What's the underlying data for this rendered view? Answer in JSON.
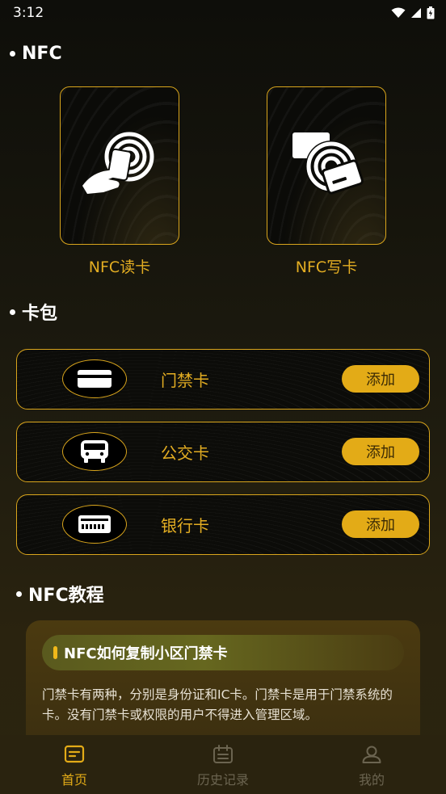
{
  "status_bar": {
    "time": "3:12"
  },
  "sections": {
    "nfc": "NFC",
    "wallet": "卡包",
    "tutorial": "NFC教程"
  },
  "nfc_actions": [
    {
      "label": "NFC读卡",
      "icon": "nfc-read-icon"
    },
    {
      "label": "NFC写卡",
      "icon": "nfc-write-icon"
    }
  ],
  "wallet": [
    {
      "name": "门禁卡",
      "icon": "access-card-icon",
      "button": "添加"
    },
    {
      "name": "公交卡",
      "icon": "bus-icon",
      "button": "添加"
    },
    {
      "name": "银行卡",
      "icon": "bank-card-icon",
      "button": "添加"
    }
  ],
  "tutorial_card": {
    "title": "NFC如何复制小区门禁卡",
    "body": "门禁卡有两种，分别是身份证和IC卡。门禁卡是用于门禁系统的卡。没有门禁卡或权限的用户不得进入管理区域。"
  },
  "bottom_nav": [
    {
      "label": "首页",
      "icon": "home-icon",
      "active": true
    },
    {
      "label": "历史记录",
      "icon": "calendar-icon",
      "active": false
    },
    {
      "label": "我的",
      "icon": "profile-icon",
      "active": false
    }
  ],
  "colors": {
    "accent": "#e3ab17",
    "border": "#d9a51c",
    "inactive_nav": "#6b6450"
  }
}
